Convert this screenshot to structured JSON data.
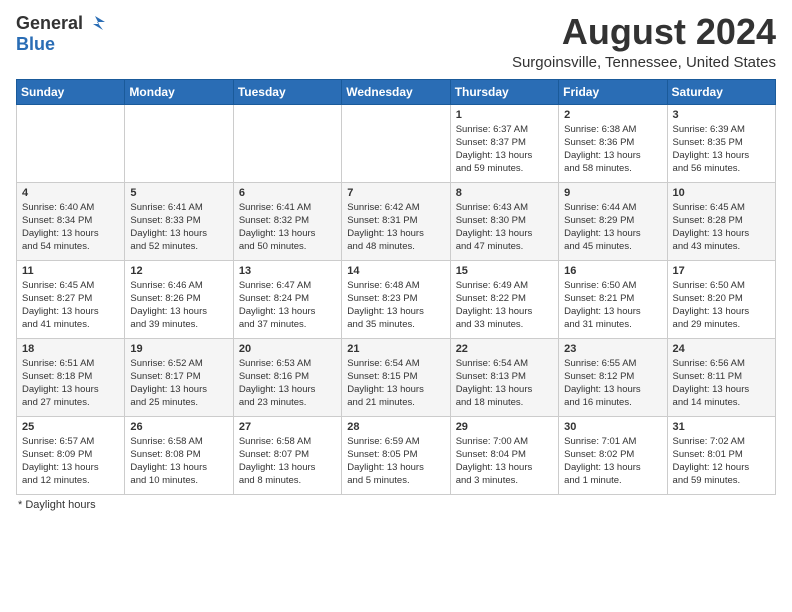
{
  "header": {
    "logo_general": "General",
    "logo_blue": "Blue",
    "month_year": "August 2024",
    "location": "Surgoinsville, Tennessee, United States"
  },
  "days_of_week": [
    "Sunday",
    "Monday",
    "Tuesday",
    "Wednesday",
    "Thursday",
    "Friday",
    "Saturday"
  ],
  "weeks": [
    [
      {
        "day": "",
        "info": ""
      },
      {
        "day": "",
        "info": ""
      },
      {
        "day": "",
        "info": ""
      },
      {
        "day": "",
        "info": ""
      },
      {
        "day": "1",
        "info": "Sunrise: 6:37 AM\nSunset: 8:37 PM\nDaylight: 13 hours\nand 59 minutes."
      },
      {
        "day": "2",
        "info": "Sunrise: 6:38 AM\nSunset: 8:36 PM\nDaylight: 13 hours\nand 58 minutes."
      },
      {
        "day": "3",
        "info": "Sunrise: 6:39 AM\nSunset: 8:35 PM\nDaylight: 13 hours\nand 56 minutes."
      }
    ],
    [
      {
        "day": "4",
        "info": "Sunrise: 6:40 AM\nSunset: 8:34 PM\nDaylight: 13 hours\nand 54 minutes."
      },
      {
        "day": "5",
        "info": "Sunrise: 6:41 AM\nSunset: 8:33 PM\nDaylight: 13 hours\nand 52 minutes."
      },
      {
        "day": "6",
        "info": "Sunrise: 6:41 AM\nSunset: 8:32 PM\nDaylight: 13 hours\nand 50 minutes."
      },
      {
        "day": "7",
        "info": "Sunrise: 6:42 AM\nSunset: 8:31 PM\nDaylight: 13 hours\nand 48 minutes."
      },
      {
        "day": "8",
        "info": "Sunrise: 6:43 AM\nSunset: 8:30 PM\nDaylight: 13 hours\nand 47 minutes."
      },
      {
        "day": "9",
        "info": "Sunrise: 6:44 AM\nSunset: 8:29 PM\nDaylight: 13 hours\nand 45 minutes."
      },
      {
        "day": "10",
        "info": "Sunrise: 6:45 AM\nSunset: 8:28 PM\nDaylight: 13 hours\nand 43 minutes."
      }
    ],
    [
      {
        "day": "11",
        "info": "Sunrise: 6:45 AM\nSunset: 8:27 PM\nDaylight: 13 hours\nand 41 minutes."
      },
      {
        "day": "12",
        "info": "Sunrise: 6:46 AM\nSunset: 8:26 PM\nDaylight: 13 hours\nand 39 minutes."
      },
      {
        "day": "13",
        "info": "Sunrise: 6:47 AM\nSunset: 8:24 PM\nDaylight: 13 hours\nand 37 minutes."
      },
      {
        "day": "14",
        "info": "Sunrise: 6:48 AM\nSunset: 8:23 PM\nDaylight: 13 hours\nand 35 minutes."
      },
      {
        "day": "15",
        "info": "Sunrise: 6:49 AM\nSunset: 8:22 PM\nDaylight: 13 hours\nand 33 minutes."
      },
      {
        "day": "16",
        "info": "Sunrise: 6:50 AM\nSunset: 8:21 PM\nDaylight: 13 hours\nand 31 minutes."
      },
      {
        "day": "17",
        "info": "Sunrise: 6:50 AM\nSunset: 8:20 PM\nDaylight: 13 hours\nand 29 minutes."
      }
    ],
    [
      {
        "day": "18",
        "info": "Sunrise: 6:51 AM\nSunset: 8:18 PM\nDaylight: 13 hours\nand 27 minutes."
      },
      {
        "day": "19",
        "info": "Sunrise: 6:52 AM\nSunset: 8:17 PM\nDaylight: 13 hours\nand 25 minutes."
      },
      {
        "day": "20",
        "info": "Sunrise: 6:53 AM\nSunset: 8:16 PM\nDaylight: 13 hours\nand 23 minutes."
      },
      {
        "day": "21",
        "info": "Sunrise: 6:54 AM\nSunset: 8:15 PM\nDaylight: 13 hours\nand 21 minutes."
      },
      {
        "day": "22",
        "info": "Sunrise: 6:54 AM\nSunset: 8:13 PM\nDaylight: 13 hours\nand 18 minutes."
      },
      {
        "day": "23",
        "info": "Sunrise: 6:55 AM\nSunset: 8:12 PM\nDaylight: 13 hours\nand 16 minutes."
      },
      {
        "day": "24",
        "info": "Sunrise: 6:56 AM\nSunset: 8:11 PM\nDaylight: 13 hours\nand 14 minutes."
      }
    ],
    [
      {
        "day": "25",
        "info": "Sunrise: 6:57 AM\nSunset: 8:09 PM\nDaylight: 13 hours\nand 12 minutes."
      },
      {
        "day": "26",
        "info": "Sunrise: 6:58 AM\nSunset: 8:08 PM\nDaylight: 13 hours\nand 10 minutes."
      },
      {
        "day": "27",
        "info": "Sunrise: 6:58 AM\nSunset: 8:07 PM\nDaylight: 13 hours\nand 8 minutes."
      },
      {
        "day": "28",
        "info": "Sunrise: 6:59 AM\nSunset: 8:05 PM\nDaylight: 13 hours\nand 5 minutes."
      },
      {
        "day": "29",
        "info": "Sunrise: 7:00 AM\nSunset: 8:04 PM\nDaylight: 13 hours\nand 3 minutes."
      },
      {
        "day": "30",
        "info": "Sunrise: 7:01 AM\nSunset: 8:02 PM\nDaylight: 13 hours\nand 1 minute."
      },
      {
        "day": "31",
        "info": "Sunrise: 7:02 AM\nSunset: 8:01 PM\nDaylight: 12 hours\nand 59 minutes."
      }
    ]
  ],
  "footer": {
    "note": "Daylight hours"
  }
}
